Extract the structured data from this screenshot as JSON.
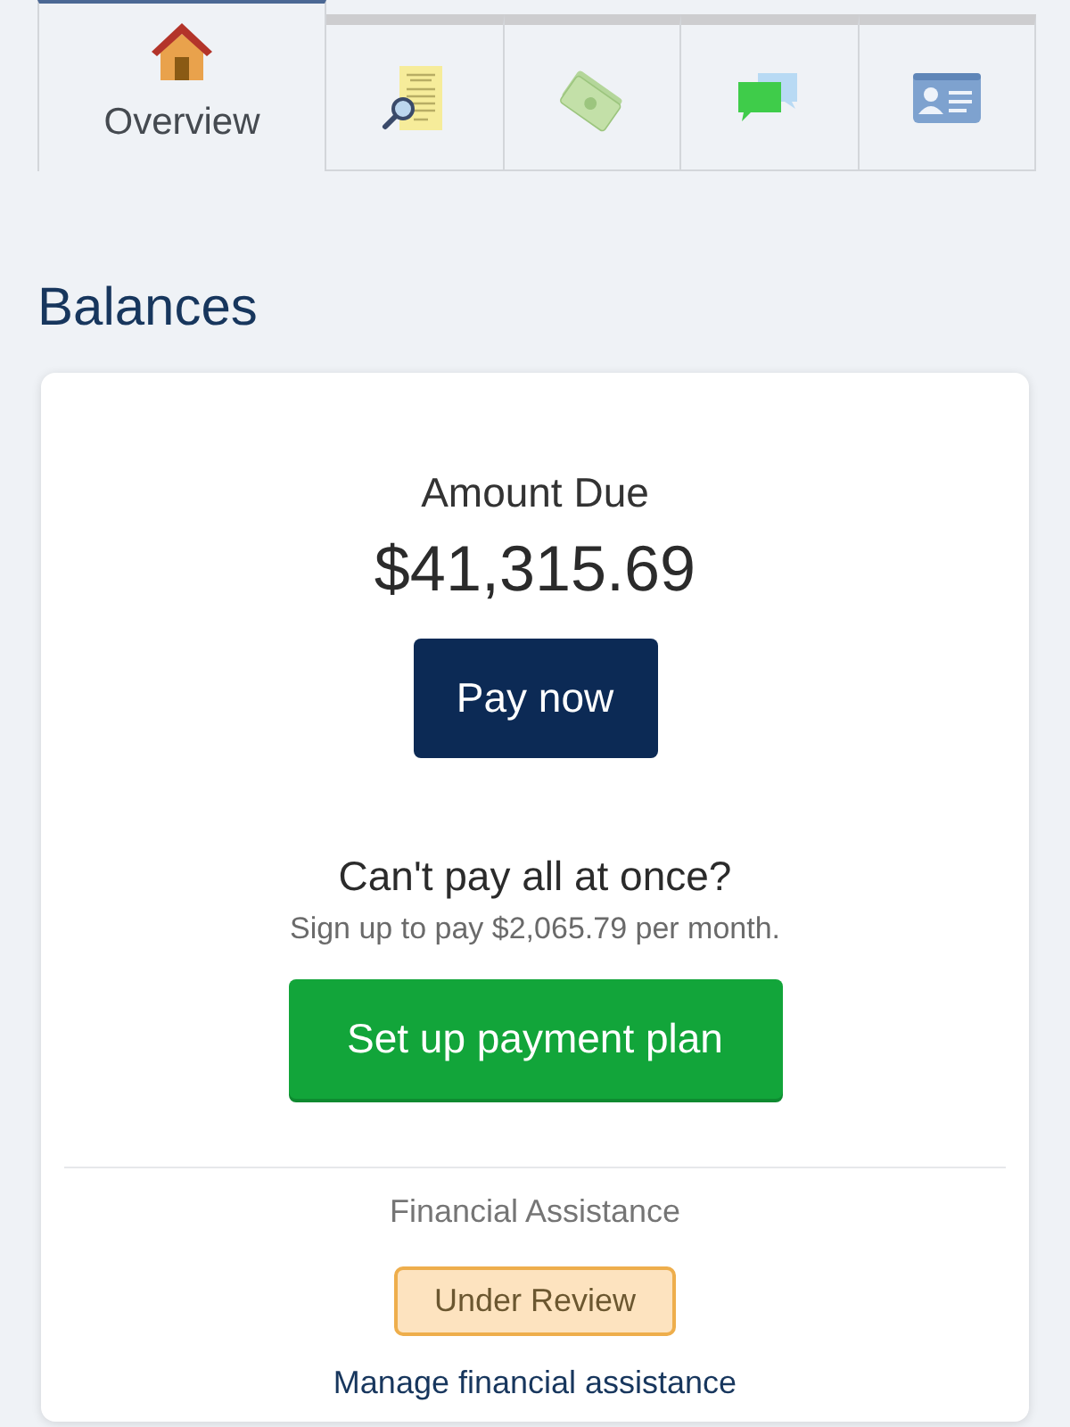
{
  "tabs": [
    {
      "label": "Overview",
      "selected": true
    },
    {
      "selected": false
    },
    {
      "selected": false
    },
    {
      "selected": false
    },
    {
      "selected": false
    }
  ],
  "section_title": "Balances",
  "balance_card": {
    "amount_label": "Amount Due",
    "amount": "$41,315.69",
    "pay_button": "Pay now",
    "plan_heading": "Can't pay all at once?",
    "plan_text": "Sign up to pay $2,065.79 per month.",
    "plan_button": "Set up payment plan",
    "assistance_label": "Financial Assistance",
    "assistance_status": "Under Review",
    "assistance_link": "Manage financial assistance"
  }
}
